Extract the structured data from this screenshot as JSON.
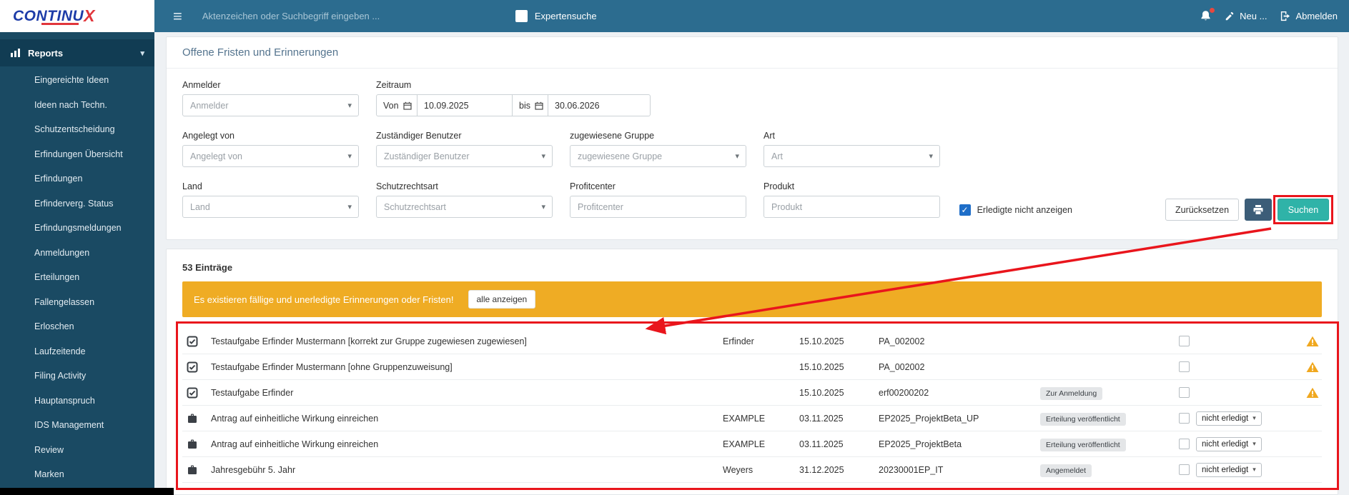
{
  "colors": {
    "topbar": "#2c6c8f",
    "sidebar": "#1a4a63",
    "accent_teal": "#2fb3a8",
    "alert_orange": "#efac24",
    "annotation_red": "#e9151c",
    "warning_orange": "#f0a81f",
    "checkbox_blue": "#1e6ec8",
    "logo_blue": "#1d3ca8",
    "logo_red": "#e1353b"
  },
  "icons": {
    "hamburger": "≡",
    "caret_down": "▾",
    "chevron_down": "▾",
    "check": "✓"
  },
  "brand": {
    "logo_text": "CONTINU",
    "logo_x": "X"
  },
  "topbar": {
    "search_placeholder": "Aktenzeichen oder Suchbegriff eingeben ...",
    "expert_search_label": "Expertensuche",
    "new_button": "Neu ...",
    "logout_button": "Abmelden"
  },
  "sidebar": {
    "section_label": "Reports",
    "items": [
      "Eingereichte Ideen",
      "Ideen nach Techn.",
      "Schutzentscheidung",
      "Erfindungen Übersicht",
      "Erfindungen",
      "Erfinderverg. Status",
      "Erfindungsmeldungen",
      "Anmeldungen",
      "Erteilungen",
      "Fallengelassen",
      "Erloschen",
      "Laufzeitende",
      "Filing Activity",
      "Hauptanspruch",
      "IDS Management",
      "Review",
      "Marken"
    ]
  },
  "page": {
    "title": "Offene Fristen und Erinnerungen"
  },
  "filters": {
    "anmelder_label": "Anmelder",
    "anmelder_placeholder": "Anmelder",
    "zeitraum_label": "Zeitraum",
    "von_label": "Von",
    "von_value": "10.09.2025",
    "bis_label": "bis",
    "bis_value": "30.06.2026",
    "angelegt_von_label": "Angelegt von",
    "angelegt_von_placeholder": "Angelegt von",
    "zust_benutzer_label": "Zuständiger Benutzer",
    "zust_benutzer_placeholder": "Zuständiger Benutzer",
    "gruppe_label": "zugewiesene Gruppe",
    "gruppe_placeholder": "zugewiesene Gruppe",
    "art_label": "Art",
    "art_placeholder": "Art",
    "land_label": "Land",
    "land_placeholder": "Land",
    "schutzrechtsart_label": "Schutzrechtsart",
    "schutzrechtsart_placeholder": "Schutzrechtsart",
    "profitcenter_label": "Profitcenter",
    "profitcenter_placeholder": "Profitcenter",
    "produkt_label": "Produkt",
    "produkt_placeholder": "Produkt",
    "erledigte_label": "Erledigte nicht anzeigen",
    "reset_button": "Zurücksetzen",
    "search_button": "Suchen"
  },
  "results": {
    "count": "53 Einträge",
    "alert_text": "Es existieren fällige und unerledigte Erinnerungen oder Fristen!",
    "alert_button": "alle anzeigen",
    "rows": [
      {
        "title": "Testaufgabe Erfinder Mustermann [korrekt zur Gruppe zugewiesen zugewiesen]",
        "person": "Erfinder",
        "date": "15.10.2025",
        "ref": "PA_002002",
        "badge": "",
        "status": ""
      },
      {
        "title": "Testaufgabe Erfinder Mustermann [ohne Gruppenzuweisung]",
        "person": "",
        "date": "15.10.2025",
        "ref": "PA_002002",
        "badge": "",
        "status": ""
      },
      {
        "title": "Testaufgabe Erfinder",
        "person": "",
        "date": "15.10.2025",
        "ref": "erf00200202",
        "badge": "Zur Anmeldung",
        "status": ""
      },
      {
        "title": "Antrag auf einheitliche Wirkung einreichen",
        "person": "EXAMPLE",
        "date": "03.11.2025",
        "ref": "EP2025_ProjektBeta_UP",
        "badge": "Erteilung veröffentlicht",
        "status": "nicht erledigt"
      },
      {
        "title": "Antrag auf einheitliche Wirkung einreichen",
        "person": "EXAMPLE",
        "date": "03.11.2025",
        "ref": "EP2025_ProjektBeta",
        "badge": "Erteilung veröffentlicht",
        "status": "nicht erledigt"
      },
      {
        "title": "Jahresgebühr 5. Jahr",
        "person": "Weyers",
        "date": "31.12.2025",
        "ref": "20230001EP_IT",
        "badge": "Angemeldet",
        "status": "nicht erledigt"
      }
    ]
  }
}
